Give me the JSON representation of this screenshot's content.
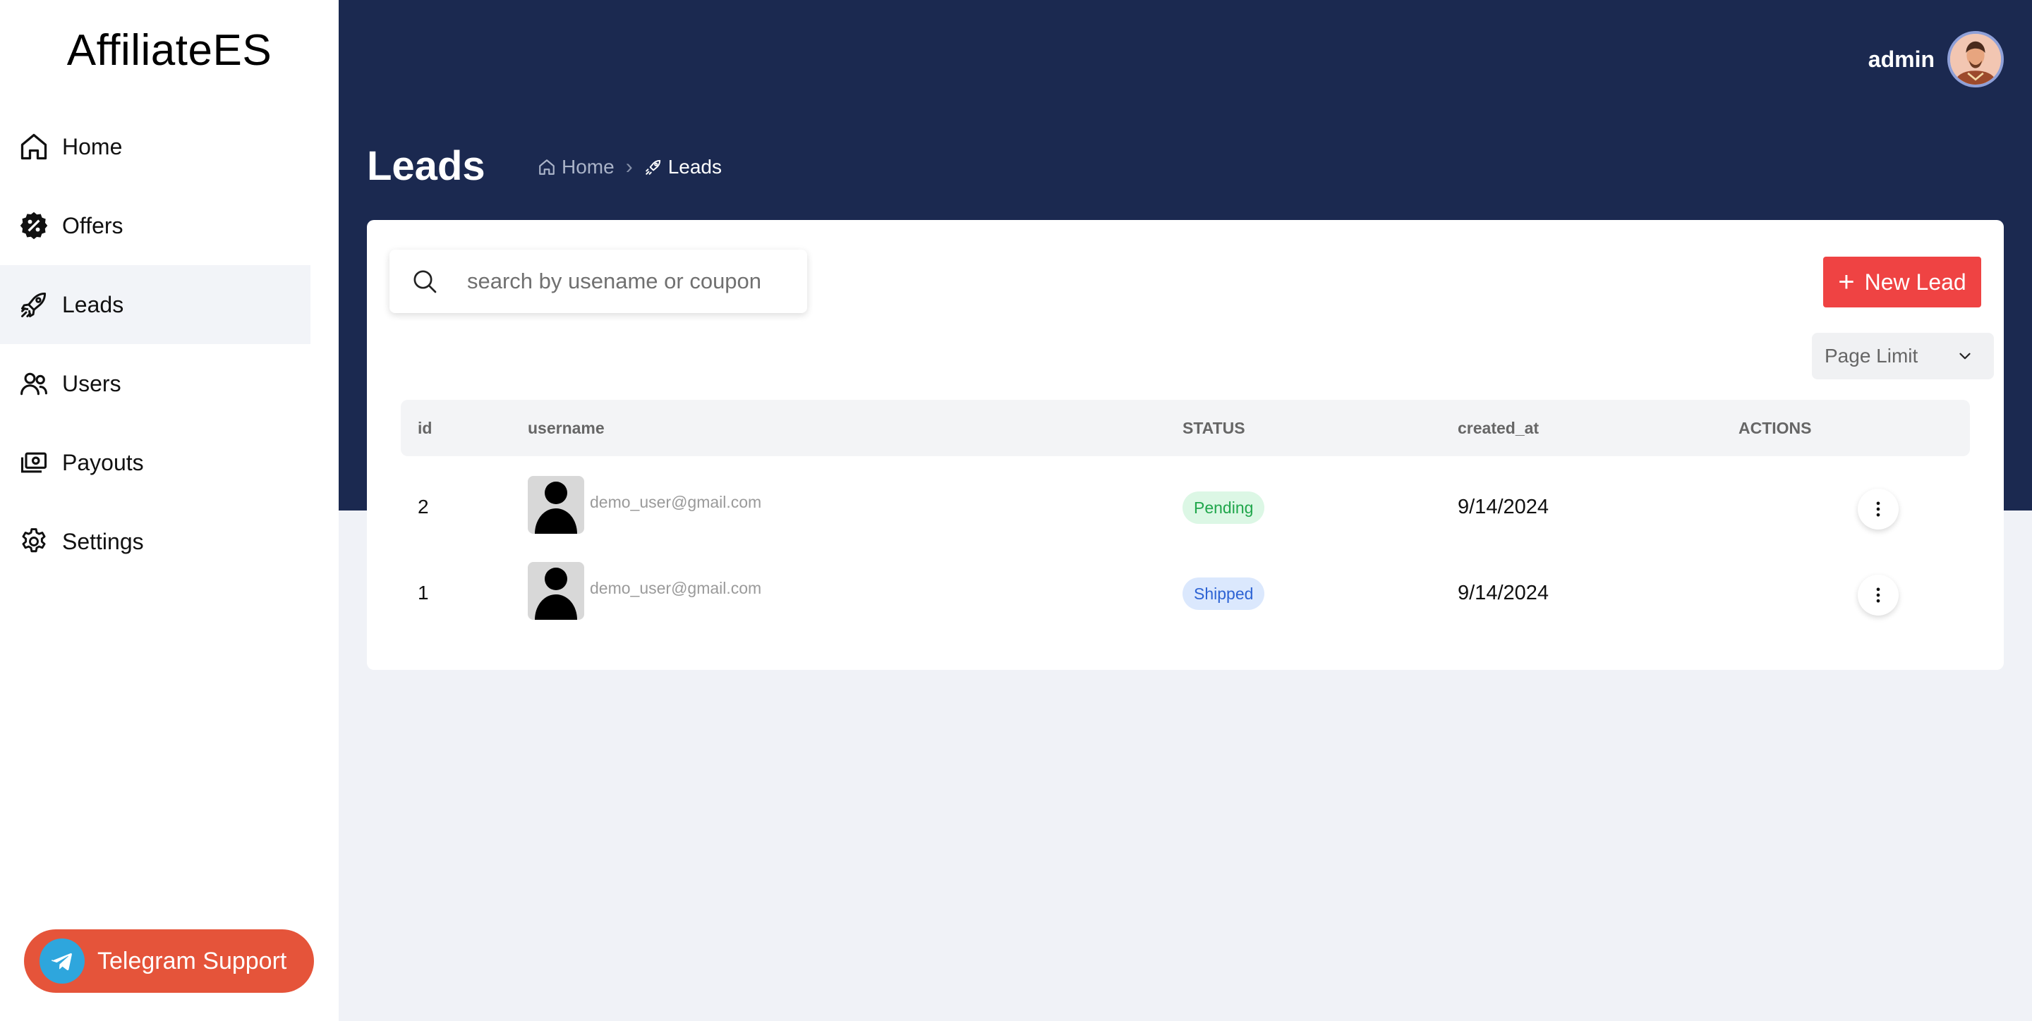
{
  "app": {
    "brand": "AffiliateES"
  },
  "sidebar": {
    "items": [
      {
        "label": "Home",
        "icon": "home-icon"
      },
      {
        "label": "Offers",
        "icon": "discount-badge-icon"
      },
      {
        "label": "Leads",
        "icon": "rocket-icon",
        "active": true
      },
      {
        "label": "Users",
        "icon": "users-icon"
      },
      {
        "label": "Payouts",
        "icon": "cash-icon"
      },
      {
        "label": "Settings",
        "icon": "gear-icon"
      }
    ],
    "support_label": "Telegram Support"
  },
  "header": {
    "username": "admin"
  },
  "page": {
    "title": "Leads",
    "breadcrumb": {
      "home": "Home",
      "current": "Leads"
    }
  },
  "toolbar": {
    "search_placeholder": "search by usename or coupon",
    "new_lead_label": "New Lead",
    "page_limit_label": "Page Limit"
  },
  "table": {
    "headers": {
      "id": "id",
      "username": "username",
      "status": "STATUS",
      "created_at": "created_at",
      "actions": "ACTIONS"
    },
    "rows": [
      {
        "id": "2",
        "email": "demo_user@gmail.com",
        "status": "Pending",
        "created_at": "9/14/2024"
      },
      {
        "id": "1",
        "email": "demo_user@gmail.com",
        "status": "Shipped",
        "created_at": "9/14/2024"
      }
    ]
  },
  "colors": {
    "header_bg": "#1b2950",
    "primary_button": "#ef4343",
    "telegram_button": "#e5543a",
    "pending": "#1fa64b",
    "shipped": "#2d63d4"
  }
}
